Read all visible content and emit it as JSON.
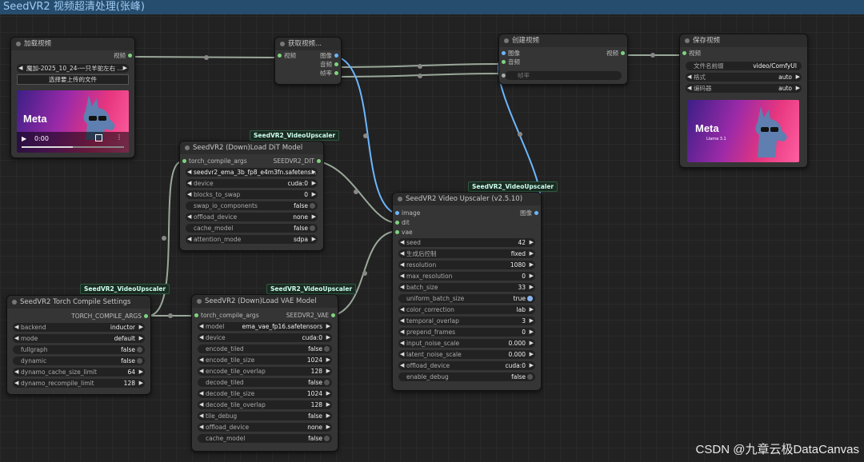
{
  "group_title": "SeedVR2 视频超清处理(张峰)",
  "nodes": {
    "load_video": {
      "title": "加载视频",
      "output": "视频",
      "file": "魔加-2025_10_24-一只羊驼左右 ...",
      "upload": "选择要上传的文件",
      "player": {
        "play": "▶",
        "time": "0:00"
      },
      "preview_brand": "Meta"
    },
    "get_video": {
      "title": "获取视频...",
      "input": "视频",
      "outputs": [
        "图像",
        "音频",
        "帧率"
      ]
    },
    "create_video": {
      "title": "创建视频",
      "inputs": [
        "图像",
        "音频"
      ],
      "output": "视频",
      "fps_label": "帧率"
    },
    "save_video": {
      "title": "保存视频",
      "input": "视频",
      "widgets": [
        {
          "label": "文件名前缀",
          "value": "video/ComfyUI"
        },
        {
          "label": "格式",
          "value": "auto"
        },
        {
          "label": "编码器",
          "value": "auto"
        }
      ],
      "preview_brand": "Meta",
      "preview_sub": "Llama 3.1"
    },
    "dit_loader": {
      "tag": "SeedVR2_VideoUpscaler",
      "title": "SeedVR2 (Down)Load DiT Model",
      "input": "torch_compile_args",
      "output": "SEEDVR2_DIT",
      "model": "seedvr2_ema_3b_fp8_e4m3fn.safetens...",
      "widgets": [
        {
          "label": "device",
          "value": "cuda:0"
        },
        {
          "label": "blocks_to_swap",
          "value": "0"
        },
        {
          "label": "swap_io_components",
          "value": "false"
        },
        {
          "label": "offload_device",
          "value": "none"
        },
        {
          "label": "cache_model",
          "value": "false"
        },
        {
          "label": "attention_mode",
          "value": "sdpa"
        }
      ]
    },
    "upscaler": {
      "tag": "SeedVR2_VideoUpscaler",
      "title": "SeedVR2 Video Upscaler (v2.5.10)",
      "inputs": [
        "image",
        "dit",
        "vae"
      ],
      "output": "图像",
      "widgets": [
        {
          "label": "seed",
          "value": "42"
        },
        {
          "label": "生成后控制",
          "value": "fixed"
        },
        {
          "label": "resolution",
          "value": "1080"
        },
        {
          "label": "max_resolution",
          "value": "0"
        },
        {
          "label": "batch_size",
          "value": "33"
        },
        {
          "label": "uniform_batch_size",
          "value": "true"
        },
        {
          "label": "color_correction",
          "value": "lab"
        },
        {
          "label": "temporal_overlap",
          "value": "3"
        },
        {
          "label": "prepend_frames",
          "value": "0"
        },
        {
          "label": "input_noise_scale",
          "value": "0.000"
        },
        {
          "label": "latent_noise_scale",
          "value": "0.000"
        },
        {
          "label": "offload_device",
          "value": "cuda:0"
        },
        {
          "label": "enable_debug",
          "value": "false"
        }
      ]
    },
    "torch_compile": {
      "tag": "SeedVR2_VideoUpscaler",
      "title": "SeedVR2 Torch Compile Settings",
      "output": "TORCH_COMPILE_ARGS",
      "widgets": [
        {
          "label": "backend",
          "value": "inductor"
        },
        {
          "label": "mode",
          "value": "default"
        },
        {
          "label": "fullgraph",
          "value": "false"
        },
        {
          "label": "dynamic",
          "value": "false"
        },
        {
          "label": "dynamo_cache_size_limit",
          "value": "64"
        },
        {
          "label": "dynamo_recompile_limit",
          "value": "128"
        }
      ]
    },
    "vae_loader": {
      "tag": "SeedVR2_VideoUpscaler",
      "title": "SeedVR2 (Down)Load VAE Model",
      "input": "torch_compile_args",
      "output": "SEEDVR2_VAE",
      "widgets": [
        {
          "label": "model",
          "value": "ema_vae_fp16.safetensors"
        },
        {
          "label": "device",
          "value": "cuda:0"
        },
        {
          "label": "encode_tiled",
          "value": "false"
        },
        {
          "label": "encode_tile_size",
          "value": "1024"
        },
        {
          "label": "encode_tile_overlap",
          "value": "128"
        },
        {
          "label": "decode_tiled",
          "value": "false"
        },
        {
          "label": "decode_tile_size",
          "value": "1024"
        },
        {
          "label": "decode_tile_overlap",
          "value": "128"
        },
        {
          "label": "tile_debug",
          "value": "false"
        },
        {
          "label": "offload_device",
          "value": "none"
        },
        {
          "label": "cache_model",
          "value": "false"
        }
      ]
    }
  },
  "watermark": "CSDN @九章云极DataCanvas",
  "colors": {
    "wire_image": "#6cb6ff",
    "wire_generic": "#9aa89a",
    "socket_green": "#7fd37f"
  }
}
